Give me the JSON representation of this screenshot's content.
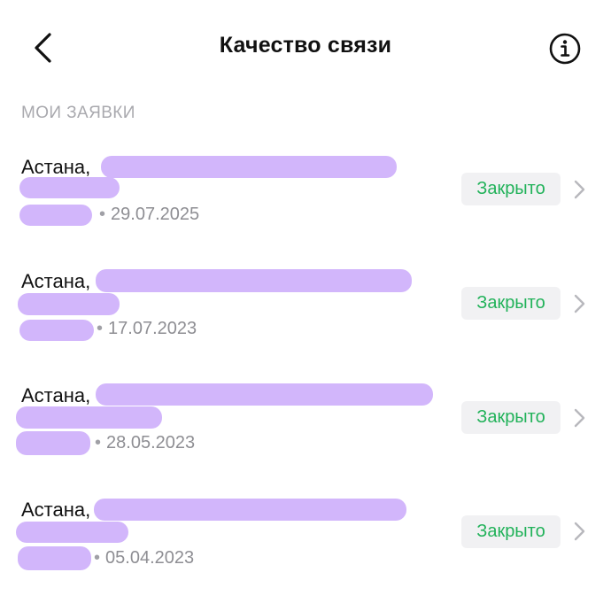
{
  "header": {
    "title": "Качество связи",
    "back_icon": "chevron-left-icon",
    "info_icon": "info-icon"
  },
  "section": {
    "label": "МОИ ЗАЯВКИ"
  },
  "requests": [
    {
      "city": "Астана,",
      "date": "29.07.2025",
      "status": "Закрыто"
    },
    {
      "city": "Астана,",
      "date": "17.07.2023",
      "status": "Закрыто"
    },
    {
      "city": "Астана,",
      "date": "28.05.2023",
      "status": "Закрыто"
    },
    {
      "city": "Астана,",
      "date": "05.04.2023",
      "status": "Закрыто"
    }
  ],
  "colors": {
    "status_closed": "#22b25a",
    "badge_bg": "#f1f1f3",
    "redaction": "#d2b6fb",
    "muted_text": "#8e8e93"
  }
}
